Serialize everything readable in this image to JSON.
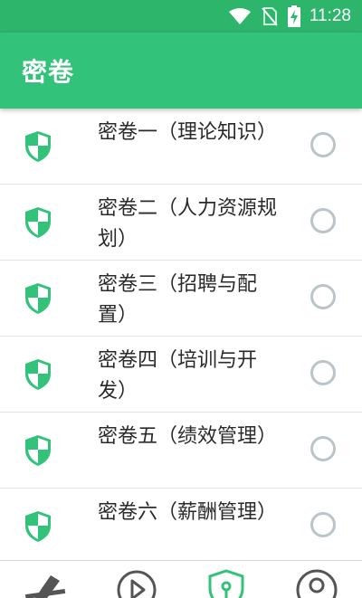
{
  "status_bar": {
    "time": "11:28"
  },
  "app_bar": {
    "title": "密卷"
  },
  "colors": {
    "primary": "#33c27a",
    "status": "#2db56c",
    "radio_border": "#b9c5c8",
    "nav_icon": "#555555"
  },
  "items": [
    {
      "label": "密卷一（理论知识）",
      "icon": "shield-icon"
    },
    {
      "label": "密卷二（人力资源规划）",
      "icon": "shield-icon"
    },
    {
      "label": "密卷三（招聘与配置）",
      "icon": "shield-icon"
    },
    {
      "label": "密卷四（培训与开发）",
      "icon": "shield-icon"
    },
    {
      "label": "密卷五（绩效管理）",
      "icon": "shield-icon"
    },
    {
      "label": "密卷六（薪酬管理）",
      "icon": "shield-icon"
    }
  ],
  "bottom_nav": [
    {
      "icon": "pen-icon"
    },
    {
      "icon": "play-icon"
    },
    {
      "icon": "shield-lock-icon",
      "active": true
    },
    {
      "icon": "user-icon"
    }
  ]
}
